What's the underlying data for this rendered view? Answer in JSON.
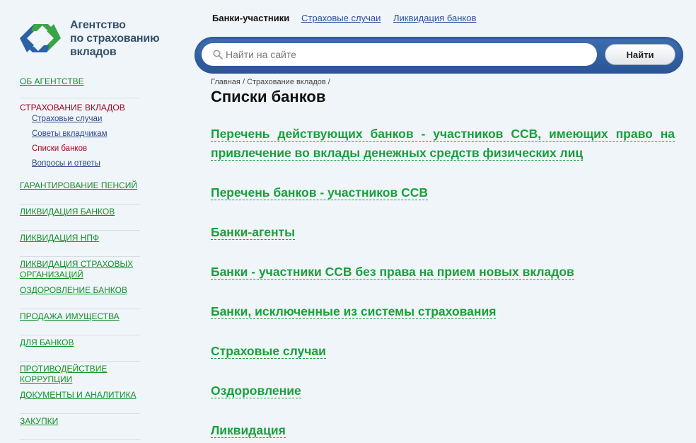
{
  "logo": {
    "text": "Агентство\nпо страхованию\nвкладов",
    "colors": {
      "blue": "#2b61a8",
      "green": "#3aa547"
    }
  },
  "top_links": [
    {
      "label": "Банки-участники",
      "current": true
    },
    {
      "label": "Страховые случаи",
      "current": false
    },
    {
      "label": "Ликвидация банков",
      "current": false
    }
  ],
  "search": {
    "placeholder": "Найти на сайте",
    "value": "",
    "button_label": "Найти",
    "icon": "search-icon"
  },
  "breadcrumb": {
    "items": [
      "Главная",
      "Страхование вкладов"
    ],
    "separator": "/"
  },
  "page": {
    "title": "Списки банков"
  },
  "sidebar": {
    "items": [
      {
        "label": "ОБ АГЕНТСТВЕ"
      },
      {
        "label": "СТРАХОВАНИЕ ВКЛАДОВ",
        "active": true
      },
      {
        "label": "ГАРАНТИРОВАНИЕ ПЕНСИЙ"
      },
      {
        "label": "ЛИКВИДАЦИЯ БАНКОВ"
      },
      {
        "label": "ЛИКВИДАЦИЯ НПФ"
      },
      {
        "label": "ЛИКВИДАЦИЯ СТРАХОВЫХ ОРГАНИЗАЦИЙ"
      },
      {
        "label": "ОЗДОРОВЛЕНИЕ БАНКОВ"
      },
      {
        "label": "ПРОДАЖА ИМУЩЕСТВА"
      },
      {
        "label": "ДЛЯ БАНКОВ"
      },
      {
        "label": "ПРОТИВОДЕЙСТВИЕ КОРРУПЦИИ"
      },
      {
        "label": "ДОКУМЕНТЫ И АНАЛИТИКА"
      },
      {
        "label": "ЗАКУПКИ"
      }
    ],
    "subitems": [
      {
        "label": "Страховые случаи"
      },
      {
        "label": "Советы вкладчикам"
      },
      {
        "label": "Списки банков",
        "active": true
      },
      {
        "label": "Вопросы и ответы"
      }
    ]
  },
  "main_links": [
    {
      "label": "Перечень действующих банков - участников ССВ, имеющих право на привлечение во вклады денежных средств физических лиц"
    },
    {
      "label": "Перечень банков - участников ССВ"
    },
    {
      "label": "Банки-агенты"
    },
    {
      "label": "Банки - участники ССВ без права на прием новых вкладов"
    },
    {
      "label": "Банки, исключенные из системы страхования"
    },
    {
      "label": "Страховые случаи"
    },
    {
      "label": "Оздоровление"
    },
    {
      "label": "Ликвидация"
    }
  ],
  "colors": {
    "nav_link": "#12902a",
    "nav_active": "#a3001b",
    "sub_link": "#2f4a88",
    "main_link": "#18a03c",
    "top_link": "#2a4f9c",
    "search_bar": "#2f5ea3"
  }
}
